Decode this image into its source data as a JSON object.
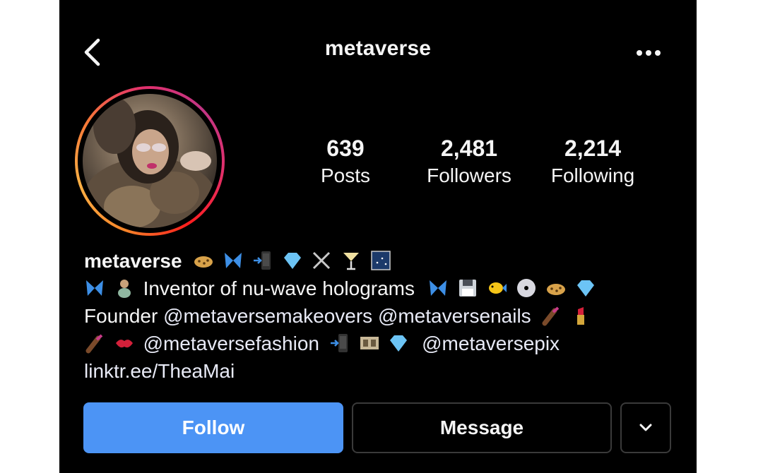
{
  "header": {
    "title": "metaverse",
    "back_icon": "chevron-left-icon",
    "more_icon": "more-horizontal-icon"
  },
  "profile": {
    "avatar_ring_colors": [
      "#f58529",
      "#e1306c",
      "#c13584"
    ],
    "stats": [
      {
        "value": "639",
        "label": "Posts"
      },
      {
        "value": "2,481",
        "label": "Followers"
      },
      {
        "value": "2,214",
        "label": "Following"
      }
    ]
  },
  "bio": {
    "name": "metaverse",
    "name_emojis": [
      "leopard",
      "butterfly",
      "phone-arrow",
      "gem",
      "crossed-swords",
      "cocktail",
      "night-sky"
    ],
    "line1_text": "Inventor of nu-wave holograms",
    "line1_emojis_before": [
      "butterfly",
      "genie"
    ],
    "line1_emojis_after": [
      "butterfly",
      "floppy-disk",
      "tropical-fish",
      "dvd",
      "leopard",
      "gem"
    ],
    "line2_prefix": "Founder",
    "line2_mentions": [
      "@metaversemakeovers",
      "@metaversenails"
    ],
    "line2_emojis_after": [
      "nail-polish",
      "lipstick"
    ],
    "line3_emojis_before": [
      "nail-polish",
      "kiss-mark"
    ],
    "line3_mention_1": "@metaversefashion",
    "line3_emojis_middle": [
      "phone-arrow",
      "film-frames",
      "gem"
    ],
    "line3_mention_2": "@metaversepix",
    "link": "linktr.ee/TheaMai"
  },
  "actions": {
    "follow_label": "Follow",
    "message_label": "Message",
    "more_icon": "chevron-down-icon",
    "follow_color": "#4c94f5"
  }
}
